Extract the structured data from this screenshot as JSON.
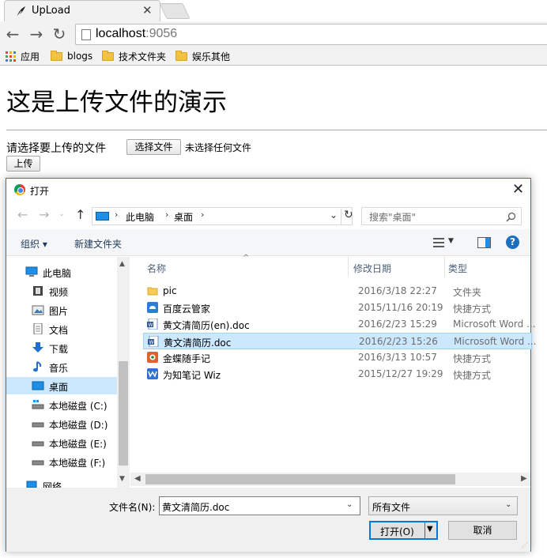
{
  "browser": {
    "tab_title": "UpLoad",
    "url_host": "localhost",
    "url_port": ":9056",
    "bookmarks": [
      {
        "label": "应用",
        "icon": "apps-grid-icon"
      },
      {
        "label": "blogs",
        "icon": "folder-icon"
      },
      {
        "label": "技术文件夹",
        "icon": "folder-icon"
      },
      {
        "label": "娱乐其他",
        "icon": "folder-icon"
      }
    ]
  },
  "page": {
    "heading": "这是上传文件的演示",
    "file_prompt": "请选择要上传的文件",
    "choose_button": "选择文件",
    "no_file": "未选择任何文件",
    "upload_button": "上传"
  },
  "dialog": {
    "title": "打开",
    "breadcrumbs": [
      "此电脑",
      "桌面"
    ],
    "search_placeholder": "搜索\"桌面\"",
    "organize": "组织 ▾",
    "new_folder": "新建文件夹",
    "nav_items": [
      {
        "label": "此电脑",
        "icon": "computer-icon"
      },
      {
        "label": "视频",
        "icon": "video-icon"
      },
      {
        "label": "图片",
        "icon": "pictures-icon"
      },
      {
        "label": "文档",
        "icon": "documents-icon"
      },
      {
        "label": "下载",
        "icon": "download-icon"
      },
      {
        "label": "音乐",
        "icon": "music-icon"
      },
      {
        "label": "桌面",
        "icon": "desktop-icon",
        "selected": true
      },
      {
        "label": "本地磁盘 (C:)",
        "icon": "drive-icon"
      },
      {
        "label": "本地磁盘 (D:)",
        "icon": "drive-icon"
      },
      {
        "label": "本地磁盘 (E:)",
        "icon": "drive-icon"
      },
      {
        "label": "本地磁盘 (F:)",
        "icon": "drive-icon"
      },
      {
        "label": "网络",
        "icon": "network-icon"
      }
    ],
    "columns": [
      "名称",
      "修改日期",
      "类型"
    ],
    "files": [
      {
        "name": "pic",
        "date": "2016/3/18 22:27",
        "type": "文件夹",
        "icon": "folder-icon"
      },
      {
        "name": "百度云管家",
        "date": "2015/11/16 20:19",
        "type": "快捷方式",
        "icon": "baidu-cloud-icon"
      },
      {
        "name": "黄文清简历(en).doc",
        "date": "2016/2/23 15:29",
        "type": "Microsoft Word ...",
        "icon": "word-doc-icon"
      },
      {
        "name": "黄文清简历.doc",
        "date": "2016/2/23 15:26",
        "type": "Microsoft Word ...",
        "icon": "word-doc-icon",
        "selected": true
      },
      {
        "name": "金蝶随手记",
        "date": "2016/3/13 10:57",
        "type": "快捷方式",
        "icon": "kingdee-icon"
      },
      {
        "name": "为知笔记 Wiz",
        "date": "2015/12/27 19:29",
        "type": "快捷方式",
        "icon": "wiz-icon"
      }
    ],
    "filename_label": "文件名(N):",
    "filename_value": "黄文清简历.doc",
    "filetype_value": "所有文件",
    "open_button": "打开(O)",
    "cancel_button": "取消"
  },
  "colors": {
    "accent": "#0078d7",
    "selection": "#cce8ff",
    "folder": "#f4c242"
  }
}
